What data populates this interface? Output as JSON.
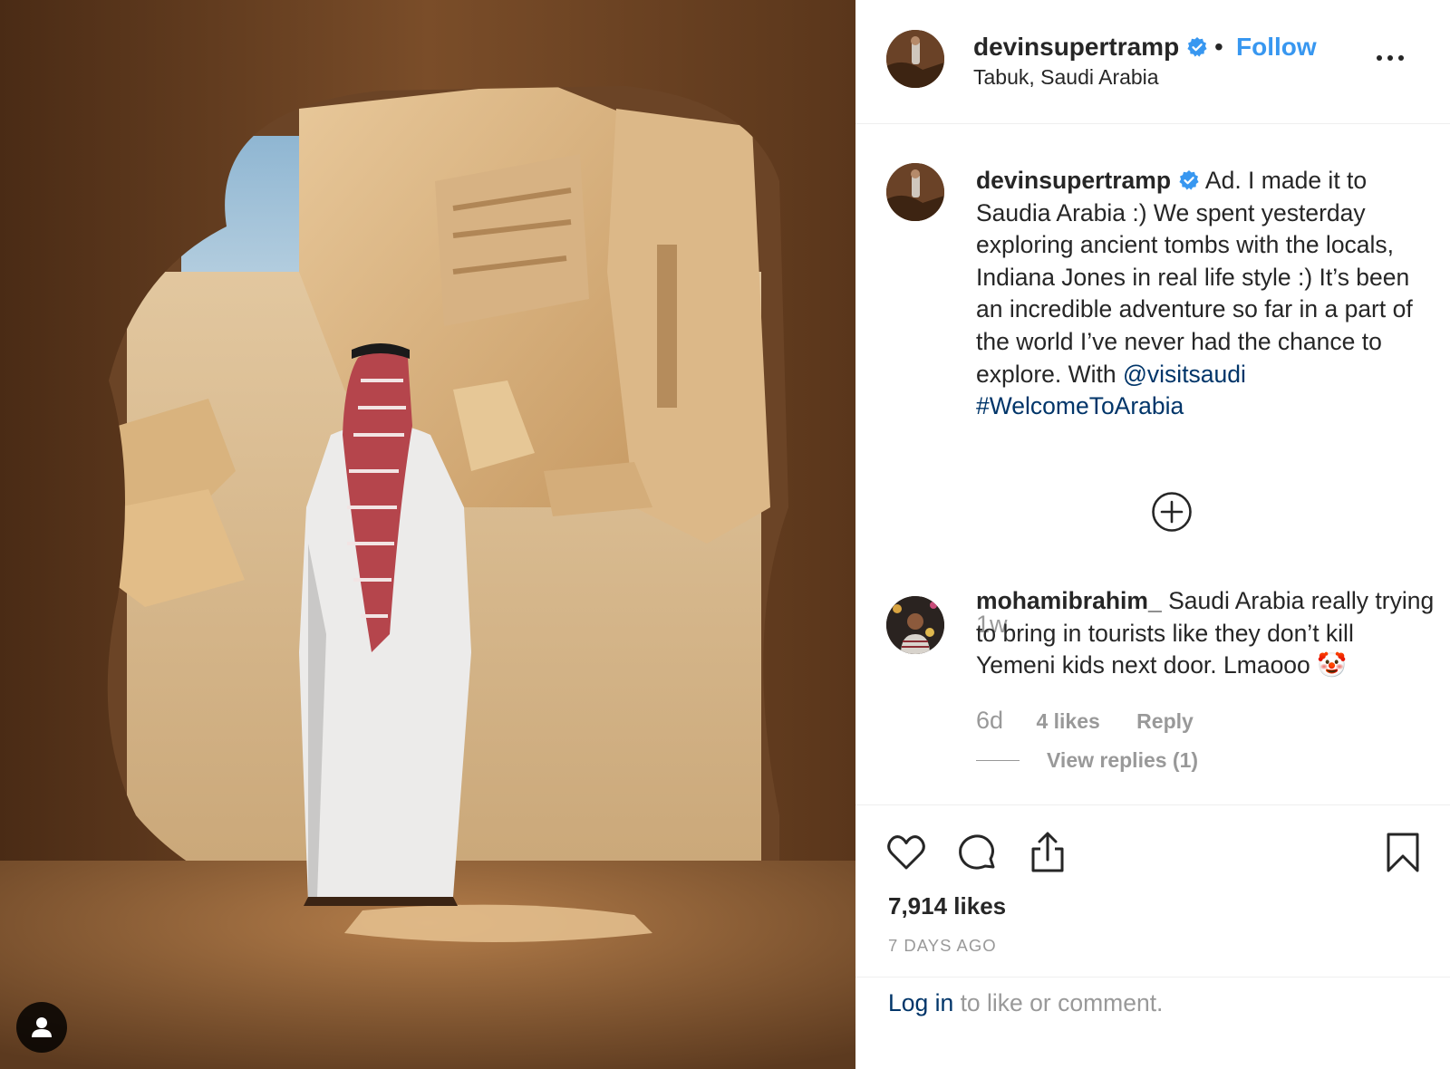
{
  "header": {
    "username": "devinsupertramp",
    "separator": "•",
    "follow_label": "Follow",
    "location": "Tabuk, Saudi Arabia"
  },
  "caption": {
    "username": "devinsupertramp",
    "text": "Ad. I made it to Saudia Arabia :) We spent yesterday exploring ancient tombs with the locals, Indiana Jones in real life style :) It’s been an incredible adventure so far in a part of the world I’ve never had the chance to explore. With",
    "mention": "@visitsaudi",
    "hashtag": "#WelcomeToArabia",
    "time": "1w"
  },
  "comment": {
    "username": "mohamibrahim_",
    "text": "Saudi Arabia really trying to bring in tourists like they don’t kill Yemeni kids next door. Lmaooo",
    "emoji": "🤡",
    "time": "6d",
    "likes": "4 likes",
    "reply_label": "Reply",
    "view_replies": "View replies (1)"
  },
  "post": {
    "likes": "7,914 likes",
    "time_ago": "7 DAYS AGO"
  },
  "login": {
    "link": "Log in",
    "rest": " to like or comment."
  },
  "icons": [
    "verified-badge-icon",
    "more-options-icon",
    "load-more-comments-icon",
    "heart-icon",
    "comment-icon",
    "share-icon",
    "bookmark-icon",
    "tagged-user-icon"
  ],
  "colors": {
    "link_blue": "#3897f0",
    "dark_link": "#003569",
    "muted": "#999999",
    "text": "#262626",
    "verified": "#3897f0"
  }
}
